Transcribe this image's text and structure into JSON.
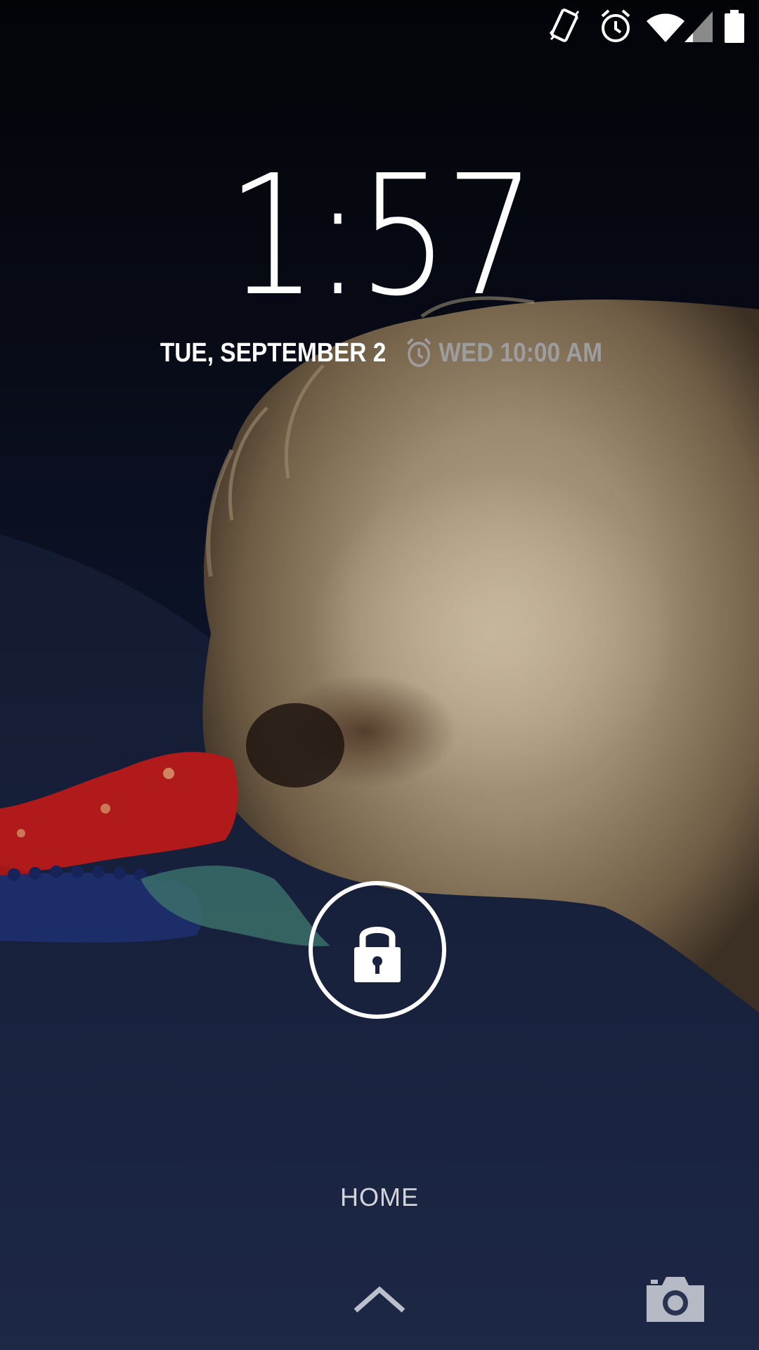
{
  "status_bar": {
    "icons": [
      "vibrate-icon",
      "alarm-icon",
      "wifi-icon",
      "cellular-signal-icon",
      "battery-icon"
    ]
  },
  "lockscreen": {
    "time": "1:57",
    "date": "TUE, SEPTEMBER 2",
    "next_alarm": "WED 10:00 AM",
    "carrier_label": "HOME"
  },
  "colors": {
    "text_primary": "#ffffff",
    "alarm_text": "#9d9d9d",
    "carrier_text": "#d2d4db"
  }
}
